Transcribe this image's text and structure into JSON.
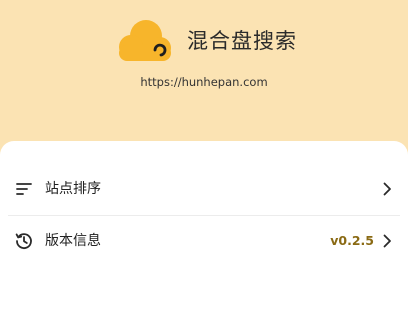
{
  "header": {
    "title": "混合盘搜索",
    "url": "https://hunhepan.com",
    "logo_icon": "cloud-icon"
  },
  "settings": {
    "items": [
      {
        "label": "站点排序",
        "icon": "sort-lines-icon"
      },
      {
        "label": "版本信息",
        "icon": "history-clock-icon",
        "value": "v0.2.5"
      }
    ]
  },
  "colors": {
    "background": "#FBE3B3",
    "logo": "#F7B52B",
    "panel": "#FFFFFF",
    "version_accent": "#8A6A14"
  }
}
